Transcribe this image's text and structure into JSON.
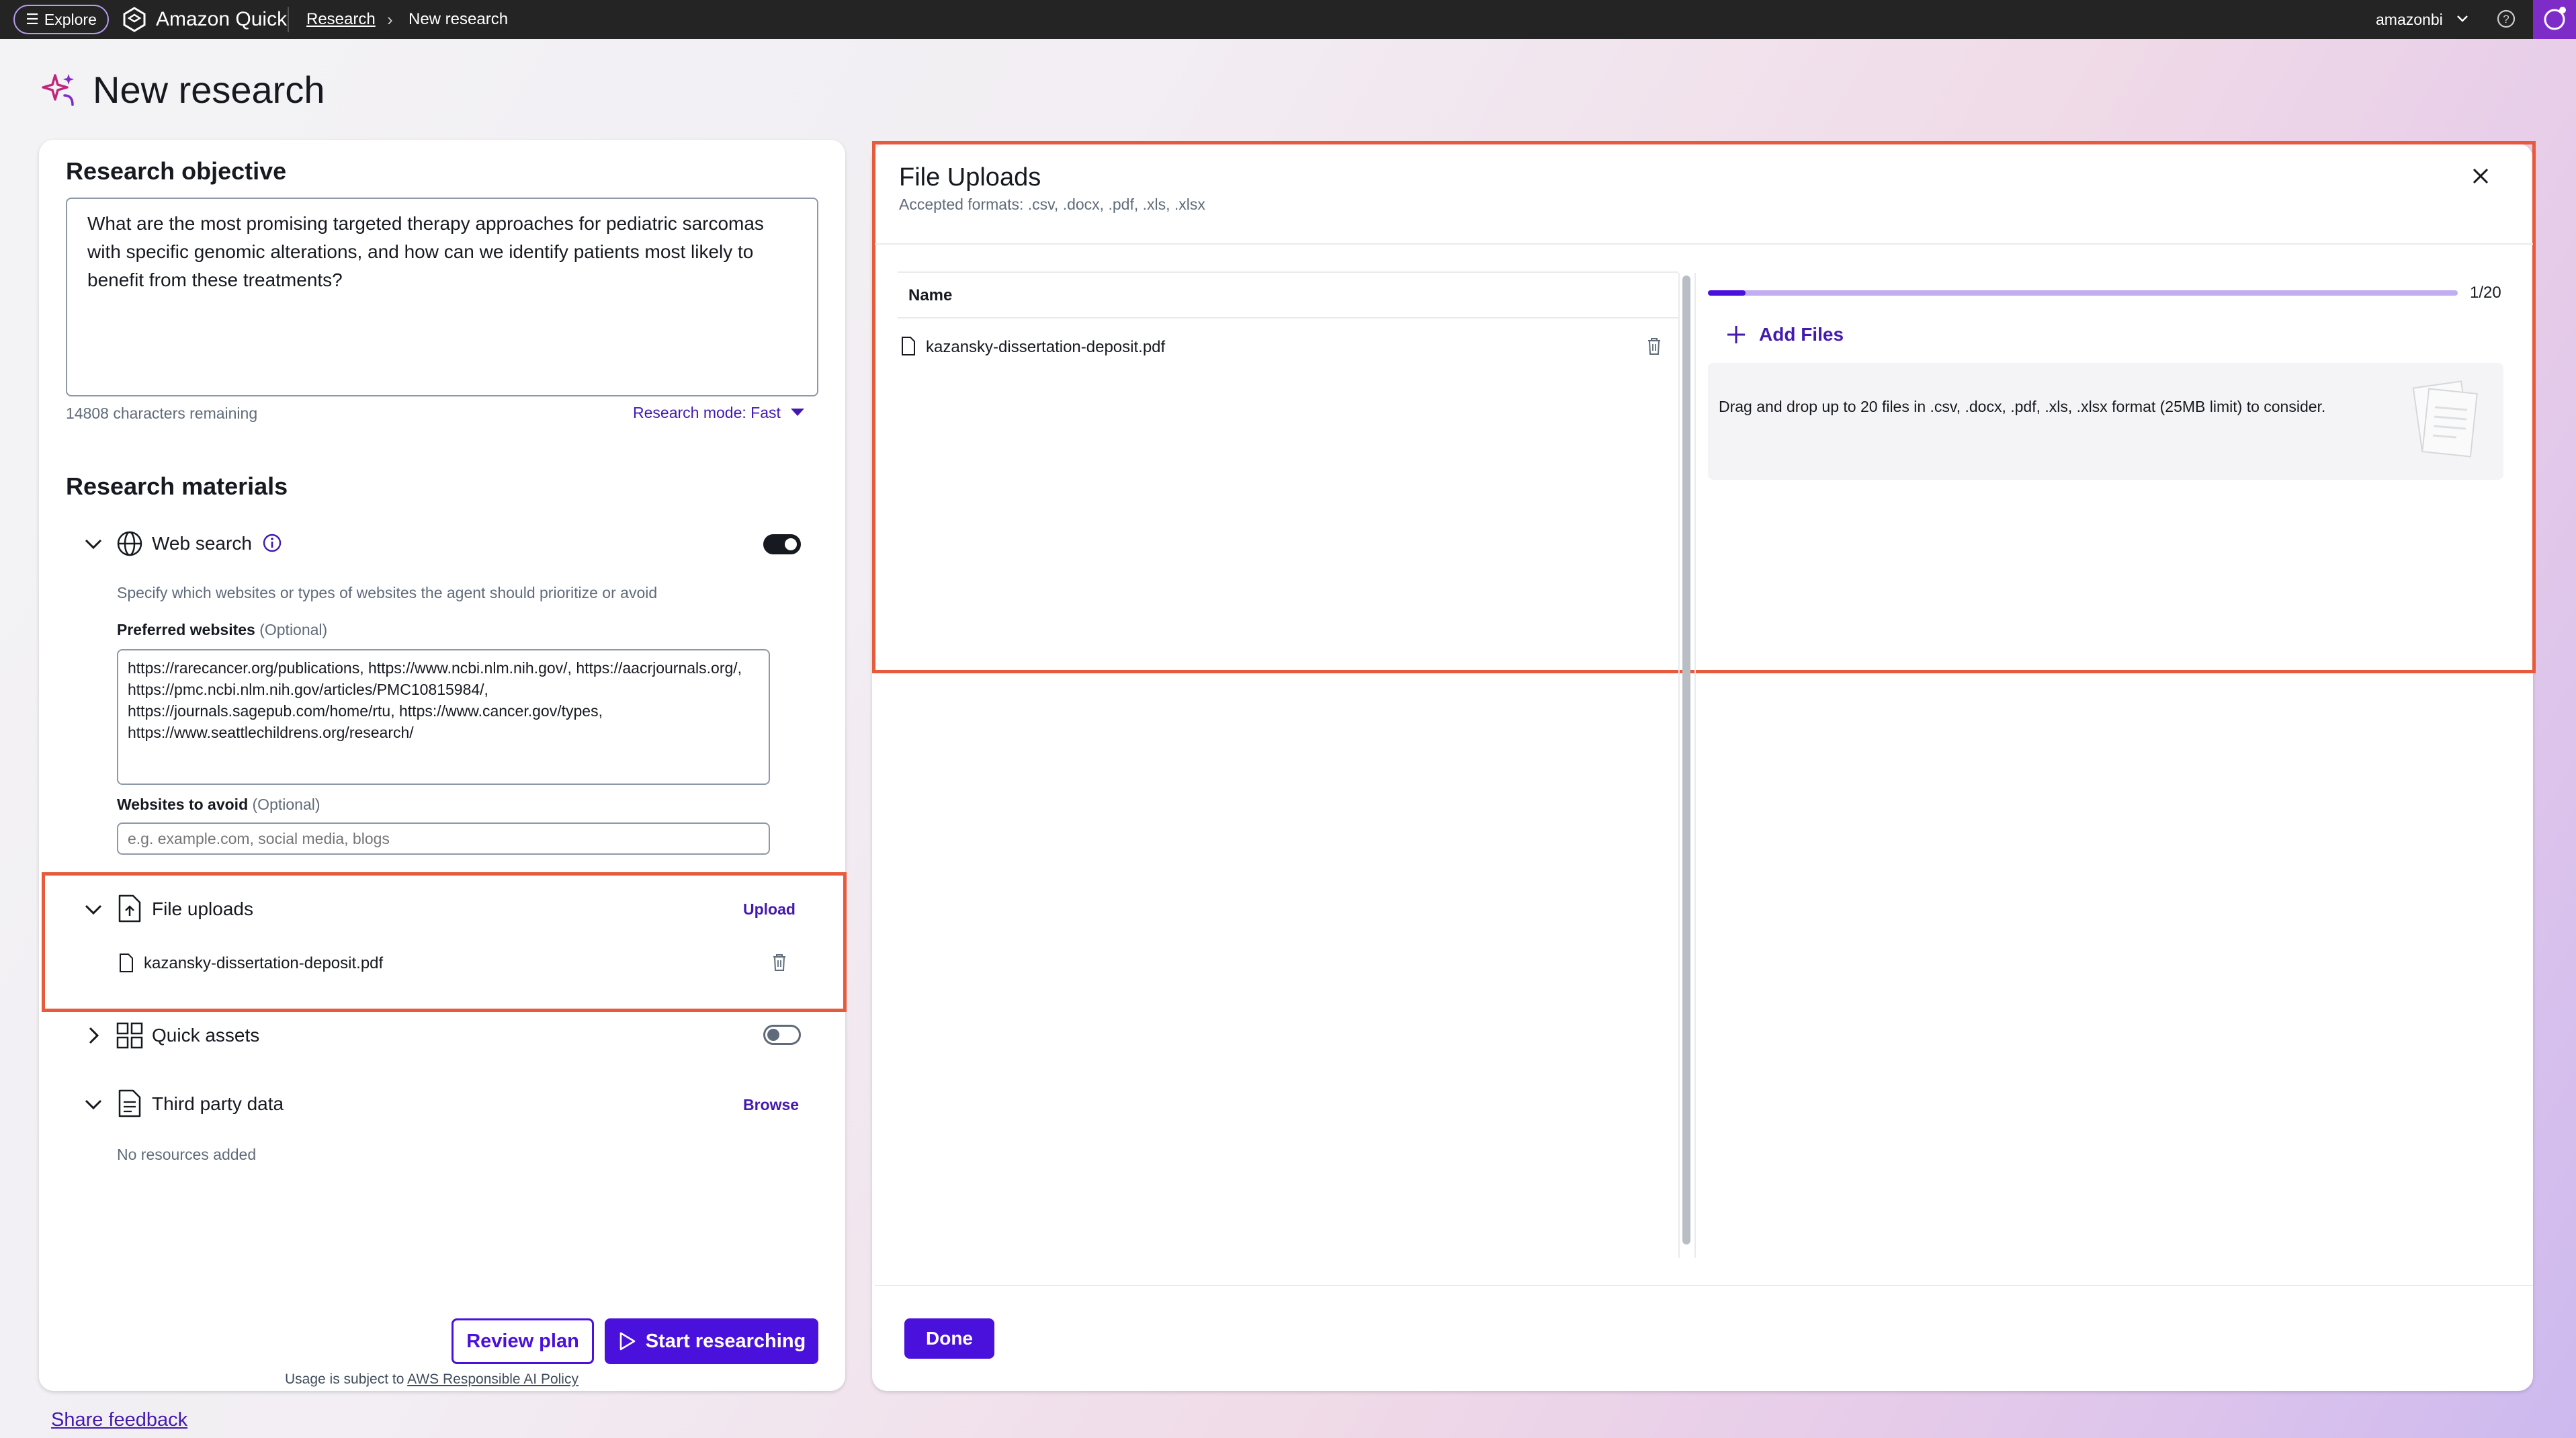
{
  "topbar": {
    "explore_label": "Explore",
    "app_title": "Amazon Quick",
    "breadcrumb_parent": "Research",
    "breadcrumb_current": "New research",
    "user": "amazonbi"
  },
  "page": {
    "title": "New research"
  },
  "objective": {
    "heading": "Research objective",
    "text": "What are the most promising targeted therapy approaches for pediatric sarcomas with specific genomic alterations, and how can we identify patients most likely to benefit from these treatments?",
    "chars_remaining": "14808 characters remaining",
    "mode_label": "Research mode: Fast"
  },
  "materials": {
    "heading": "Research materials",
    "web_search": {
      "label": "Web search",
      "enabled": true,
      "hint": "Specify which websites or types of websites the agent should prioritize or avoid",
      "preferred_label": "Preferred websites",
      "optional": "(Optional)",
      "preferred_value": "https://rarecancer.org/publications, https://www.ncbi.nlm.nih.gov/, https://aacrjournals.org/, https://pmc.ncbi.nlm.nih.gov/articles/PMC10815984/, https://journals.sagepub.com/home/rtu, https://www.cancer.gov/types, https://www.seattlechildrens.org/research/",
      "avoid_label": "Websites to avoid",
      "avoid_placeholder": "e.g. example.com, social media, blogs"
    },
    "file_uploads": {
      "label": "File uploads",
      "action": "Upload",
      "file": "kazansky-dissertation-deposit.pdf"
    },
    "quick_assets": {
      "label": "Quick assets",
      "enabled": false
    },
    "third_party": {
      "label": "Third party data",
      "action": "Browse",
      "empty": "No resources added"
    }
  },
  "actions": {
    "review": "Review plan",
    "start": "Start researching",
    "usage_prefix": "Usage is subject to",
    "usage_link": "AWS Responsible AI Policy"
  },
  "feedback": "Share feedback",
  "modal": {
    "title": "File Uploads",
    "formats": "Accepted formats: .csv, .docx, .pdf, .xls, .xlsx",
    "col_name": "Name",
    "file": "kazansky-dissertation-deposit.pdf",
    "count": "1/20",
    "progress": 0.05,
    "add_files": "Add Files",
    "drop_text": "Drag and drop up to 20 files in .csv, .docx, .pdf, .xls, .xlsx format (25MB limit) to consider.",
    "done": "Done"
  },
  "colors": {
    "accent": "#4a10dc",
    "highlight": "#e85a3c",
    "topbar": "#242424"
  }
}
